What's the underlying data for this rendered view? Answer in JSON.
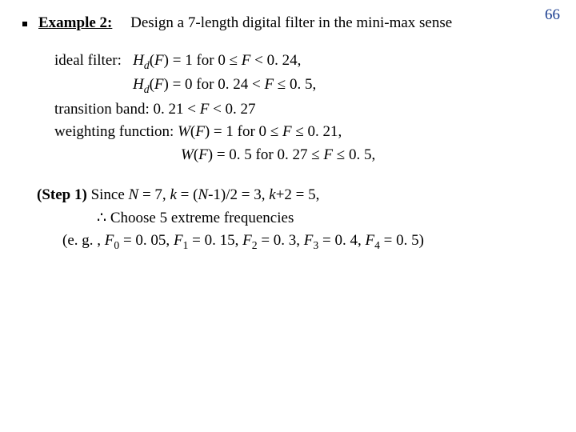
{
  "page_number": "66",
  "example": {
    "label": "Example 2:",
    "title": "Design a 7-length digital filter in the mini-max sense"
  },
  "spec": {
    "ideal_label": "ideal filter:",
    "hd1_a": "H",
    "hd1_b": "d",
    "hd1_c": "(",
    "hd1_d": "F",
    "hd1_e": ") = 1 for  0 ",
    "le": "≤",
    "hd1_f": " F",
    "hd1_g": " < 0. 24,",
    "hd2_a": "H",
    "hd2_b": "d",
    "hd2_c": "(",
    "hd2_d": "F",
    "hd2_e": ") = 0 for  0. 24 < ",
    "hd2_f": "F",
    "hd2_g": " ",
    "hd2_h": " 0. 5,",
    "tb_label": "transition band:  0. 21 < ",
    "tb_f": "F",
    "tb_tail": " < 0. 27",
    "wf_label": "weighting function: ",
    "w1_a": "W",
    "w1_b": "(",
    "w1_c": "F",
    "w1_d": ") = 1 for 0 ",
    "w1_f": "F",
    "w1_tail": " 0. 21,",
    "w2_a": "W",
    "w2_b": "(",
    "w2_c": "F",
    "w2_d": ") = 0. 5 for 0. 27 ",
    "w2_f": "F",
    "w2_tail": " 0. 5,"
  },
  "step1": {
    "head_a": "(Step 1)",
    "head_b": " Since ",
    "N": "N",
    "eq1": " = 7, ",
    "k": "k",
    "eq2": " = (",
    "Nm": "N",
    "eq3": "-1)/2 = 3, ",
    "k2": "k",
    "eq4": "+2 = 5,",
    "arrow": "∴",
    "arrow_txt": " Choose 5 extreme frequencies",
    "eg_a": "(e. g. , ",
    "F": "F",
    "s0": "0",
    "v0": " = 0. 05, ",
    "s1": "1",
    "v1": " = 0. 15, ",
    "s2": "2",
    "v2": " = 0. 3, ",
    "s3": "3",
    "v3": " = 0. 4, ",
    "s4": "4",
    "v4": " = 0. 5)"
  }
}
